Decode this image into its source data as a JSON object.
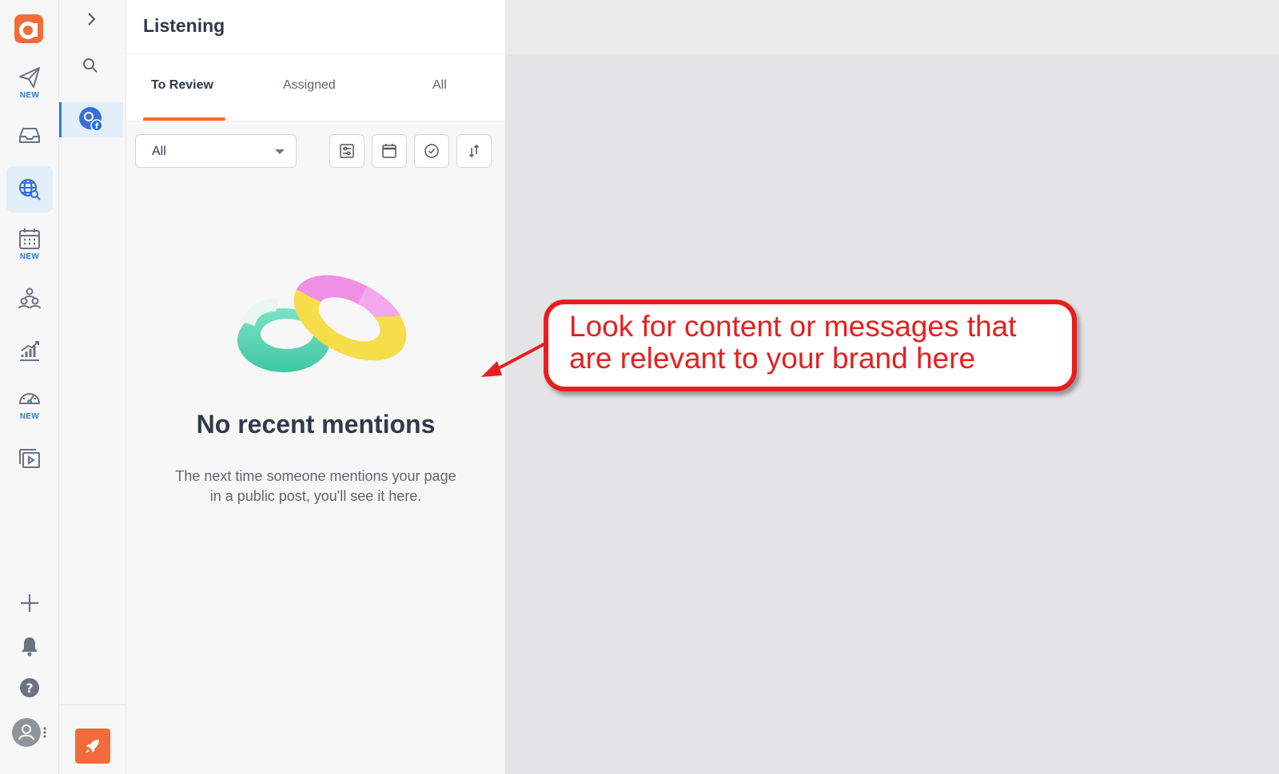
{
  "rail": {
    "items": [
      {
        "name": "publish",
        "badge": "NEW"
      },
      {
        "name": "inbox",
        "badge": ""
      },
      {
        "name": "listening",
        "badge": ""
      },
      {
        "name": "planner",
        "badge": "NEW"
      },
      {
        "name": "audience",
        "badge": ""
      },
      {
        "name": "analytics",
        "badge": ""
      },
      {
        "name": "dashboard",
        "badge": "NEW"
      },
      {
        "name": "media",
        "badge": ""
      }
    ],
    "active": "listening"
  },
  "panel": {
    "title": "Listening",
    "tabs": [
      {
        "label": "To Review",
        "active": true
      },
      {
        "label": "Assigned",
        "active": false
      },
      {
        "label": "All",
        "active": false
      }
    ],
    "filter": {
      "selected": "All"
    },
    "empty_state": {
      "title": "No recent mentions",
      "description": "The next time someone mentions your page in a public post, you'll see it here."
    }
  },
  "annotation": {
    "text": "Look for content or messages that\nare relevant to your brand here",
    "color": "#e81e1e"
  },
  "colors": {
    "accent": "#f26b3a",
    "active_blue": "#2f7ad8"
  }
}
